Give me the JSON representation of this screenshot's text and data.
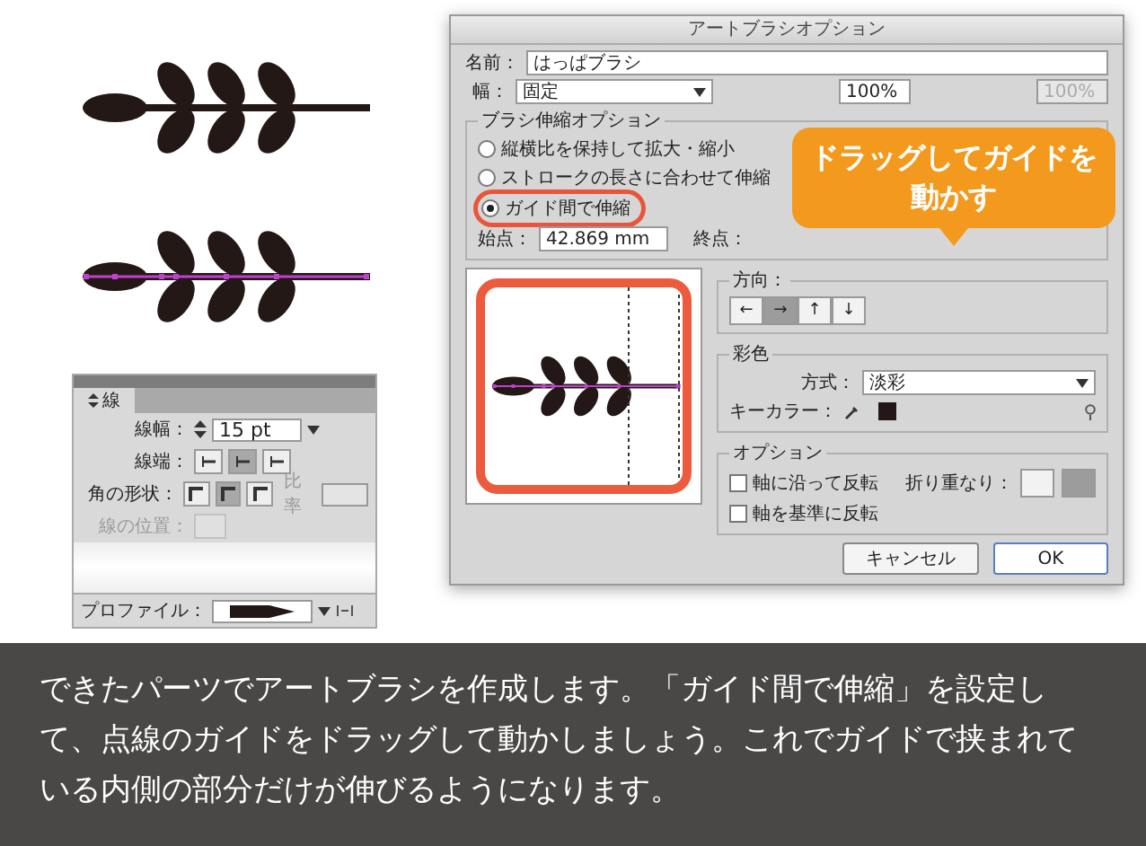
{
  "artwork": {
    "leaves": [
      {
        "kind": "plain"
      },
      {
        "kind": "guided"
      }
    ]
  },
  "stroke_panel": {
    "tab": "線",
    "weight_label": "線幅：",
    "weight_value": "15 pt",
    "cap_label": "線端：",
    "caps": [
      {
        "selected": false
      },
      {
        "selected": true
      },
      {
        "selected": false
      }
    ],
    "corner_label": "角の形状：",
    "corners": [
      {
        "selected": false
      },
      {
        "selected": true
      },
      {
        "selected": false
      }
    ],
    "limit_label": "比率",
    "align_label": "線の位置：",
    "profile_label": "プロファイル："
  },
  "dialog": {
    "title": "アートブラシオプション",
    "name_label": "名前：",
    "name_value": "はっぱブラシ",
    "width_label": "幅：",
    "width_value": "固定",
    "width_percent": "100%",
    "width_percent_max": "100%",
    "scale": {
      "legend": "ブラシ伸縮オプション",
      "options": [
        {
          "label": "縦横比を保持して拡大・縮小",
          "selected": false
        },
        {
          "label": "ストロークの長さに合わせて伸縮",
          "selected": false
        },
        {
          "label": "ガイド間で伸縮",
          "selected": true
        }
      ],
      "start_label": "始点：",
      "start_value": "42.869 mm",
      "end_label": "終点："
    },
    "direction": {
      "legend": "方向：",
      "buttons": [
        {
          "symbol": "←",
          "selected": false
        },
        {
          "symbol": "→",
          "selected": true
        },
        {
          "symbol": "↑",
          "selected": false
        },
        {
          "symbol": "↓",
          "selected": false
        }
      ]
    },
    "colorization": {
      "legend": "彩色",
      "method_label": "方式：",
      "method_value": "淡彩",
      "key_color_label": "キーカラー："
    },
    "options": {
      "legend": "オプション",
      "checks": [
        {
          "label": "軸に沿って反転",
          "checked": false
        },
        {
          "label": "軸を基準に反転",
          "checked": false
        }
      ],
      "overlap_label": "折り重なり：",
      "overlap": [
        {
          "selected": false
        },
        {
          "selected": true
        }
      ]
    },
    "buttons": [
      {
        "label": "キャンセル",
        "kind": "secondary"
      },
      {
        "label": "OK",
        "kind": "default"
      }
    ]
  },
  "callout": {
    "lines": [
      "ドラッグしてガイドを",
      "動かす"
    ]
  },
  "caption": "できたパーツでアートブラシを作成します。「ガイド間で伸縮」を設定して、点線のガイドをドラッグして動かしましょう。これでガイドで挟まれている内側の部分だけが伸びるようになります。"
}
